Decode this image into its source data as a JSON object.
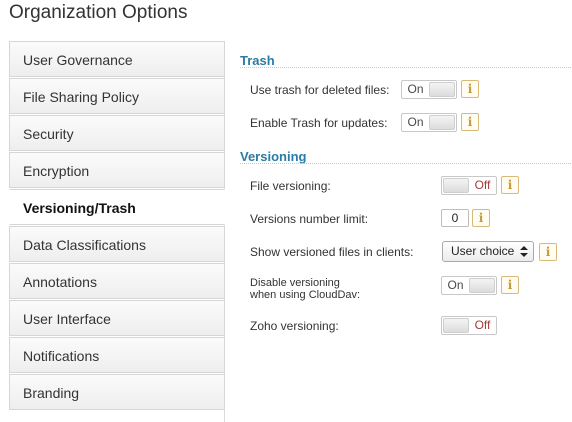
{
  "page": {
    "title": "Organization Options"
  },
  "sidebar": {
    "items": [
      {
        "label": "User Governance"
      },
      {
        "label": "File Sharing Policy"
      },
      {
        "label": "Security"
      },
      {
        "label": "Encryption"
      },
      {
        "label": "Versioning/Trash",
        "active": true
      },
      {
        "label": "Data Classifications"
      },
      {
        "label": "Annotations"
      },
      {
        "label": "User Interface"
      },
      {
        "label": "Notifications"
      },
      {
        "label": "Branding"
      }
    ]
  },
  "trash": {
    "title": "Trash",
    "use_trash": {
      "label": "Use trash for deleted files:",
      "state": "On"
    },
    "enable_updates": {
      "label": "Enable Trash for updates:",
      "state": "On"
    }
  },
  "versioning": {
    "title": "Versioning",
    "file_versioning": {
      "label": "File versioning:",
      "state": "Off"
    },
    "number_limit": {
      "label": "Versions number limit:",
      "value": "0"
    },
    "show_in_clients": {
      "label": "Show versioned files in clients:",
      "selected": "User choice"
    },
    "disable_clouddav": {
      "label_line1": "Disable versioning",
      "label_line2": "when using CloudDav:",
      "state": "On"
    },
    "zoho": {
      "label": "Zoho versioning:",
      "state": "Off"
    }
  },
  "icons": {
    "info": "i",
    "info_name": "info-icon",
    "select_arrows": "up-down-arrows-icon"
  },
  "colors": {
    "section_title": "#2a7ba6",
    "off_text": "#a23a3a",
    "info_border": "#d9b97a"
  }
}
